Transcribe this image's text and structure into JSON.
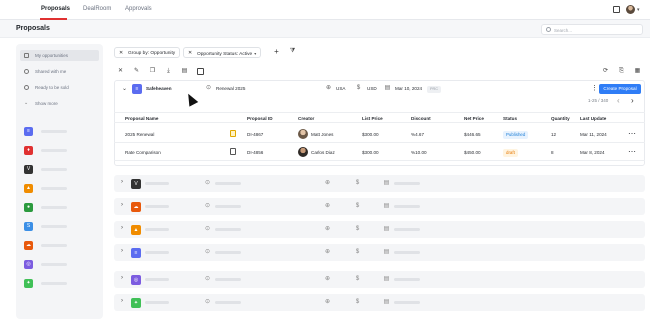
{
  "nav": {
    "tabs": [
      "Proposals",
      "DealRoom",
      "Approvals"
    ]
  },
  "page": {
    "title": "Proposals",
    "search_placeholder": "Search..."
  },
  "sidebar": {
    "items": [
      {
        "label": "My opportunities",
        "icon": "grid-icon"
      },
      {
        "label": "Shared with me",
        "icon": "users-icon"
      },
      {
        "label": "Ready to be sold",
        "icon": "check-circle-icon"
      },
      {
        "label": "Show more",
        "icon": "chevron-down-icon"
      }
    ],
    "apps": [
      {
        "color": "#5b6cf0",
        "glyph": "≡"
      },
      {
        "color": "#e03131",
        "glyph": "♦"
      },
      {
        "color": "#333333",
        "glyph": "V"
      },
      {
        "color": "#f08c00",
        "glyph": "▲"
      },
      {
        "color": "#2b9a3e",
        "glyph": "●"
      },
      {
        "color": "#3b8fe6",
        "glyph": "S"
      },
      {
        "color": "#e8590c",
        "glyph": "☁"
      },
      {
        "color": "#7c5ce0",
        "glyph": "◎"
      },
      {
        "color": "#40c057",
        "glyph": "✦"
      }
    ]
  },
  "toolbar": {
    "group_chip": "Group by: Opportunity",
    "status_chip": "Opportunity Status: Active"
  },
  "group": {
    "name": "Safeheaven",
    "deal": "Renewal 2025",
    "country": "USA",
    "currency": "USD",
    "date": "Mar 10, 2024",
    "stage": "PRC",
    "create_label": "Create Proposal",
    "pager": "1-25 / 340"
  },
  "table": {
    "headers": [
      "Proposal Name",
      "Proposal ID",
      "Creator",
      "List Price",
      "Discount",
      "Net Price",
      "Status",
      "Quantity",
      "Last Update"
    ],
    "rows": [
      {
        "name": "2025 Renewal",
        "id": "DI-4867",
        "creator": "Matt Jones",
        "list_price": "$300.00",
        "discount": "%4.67",
        "net_price": "$446.65",
        "status": "Published",
        "status_color": "#1c7ed6",
        "status_bg": "#e7f2fe",
        "quantity": "12",
        "updated": "Mar 11, 2024"
      },
      {
        "name": "Rate Comparison",
        "id": "DI-4856",
        "creator": "Carlos Diaz",
        "list_price": "$300.00",
        "discount": "%10.00",
        "net_price": "$450.00",
        "status": "draft",
        "status_color": "#e67700",
        "status_bg": "#fff4e0",
        "quantity": "8",
        "updated": "Mar 8, 2024"
      }
    ]
  },
  "collapsed_groups": [
    {
      "color": "#333333",
      "glyph": "V"
    },
    {
      "color": "#e8590c",
      "glyph": "☁"
    },
    {
      "color": "#f08c00",
      "glyph": "▲"
    },
    {
      "color": "#5b6cf0",
      "glyph": "≡"
    },
    {
      "color": "#7c5ce0",
      "glyph": "◎"
    },
    {
      "color": "#40c057",
      "glyph": "✦"
    }
  ]
}
